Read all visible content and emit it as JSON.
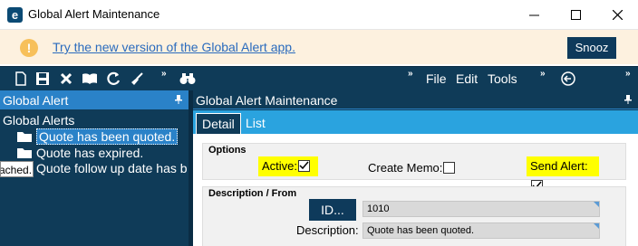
{
  "window": {
    "title": "Global Alert Maintenance",
    "app_icon_letter": "e"
  },
  "banner": {
    "link_text": "Try the new version of the Global Alert app.",
    "snooze_label": "Snooz",
    "icon": "warning-icon",
    "icon_glyph": "!"
  },
  "toolbar": {
    "icons": [
      "new-icon",
      "save-icon",
      "delete-icon",
      "book-icon",
      "refresh-icon",
      "clear-icon",
      "binoculars-icon",
      "back-icon"
    ],
    "overflow_glyph": "»",
    "menus": [
      "File",
      "Edit",
      "Tools"
    ]
  },
  "left_panel": {
    "title": "Global Alert",
    "tree_root": "Global Alerts",
    "items": [
      {
        "label": "Quote has been quoted.",
        "selected": true
      },
      {
        "label": "Quote has expired.",
        "selected": false
      },
      {
        "label": "Quote follow up date has b",
        "selected": false
      }
    ],
    "tooltip": "ached."
  },
  "right_panel": {
    "title": "Global Alert Maintenance",
    "tabs": [
      {
        "label": "Detail",
        "active": true
      },
      {
        "label": "List",
        "active": false
      }
    ]
  },
  "options": {
    "title": "Options",
    "active": {
      "label": "Active:",
      "checked": true
    },
    "create_memo": {
      "label": "Create Memo:",
      "checked": false
    },
    "send_alert": {
      "label": "Send Alert:",
      "checked": true
    }
  },
  "description_section": {
    "title": "Description / From",
    "id_button": "ID...",
    "id_value": "1010",
    "description_label": "Description:",
    "description_value": "Quote has been quoted."
  },
  "colors": {
    "dark_navy": "#0f3b58",
    "header_blue": "#2a82c8",
    "tab_bar_blue": "#2aa3df",
    "banner_bg": "#fdf1df",
    "highlight": "#ffff00"
  }
}
